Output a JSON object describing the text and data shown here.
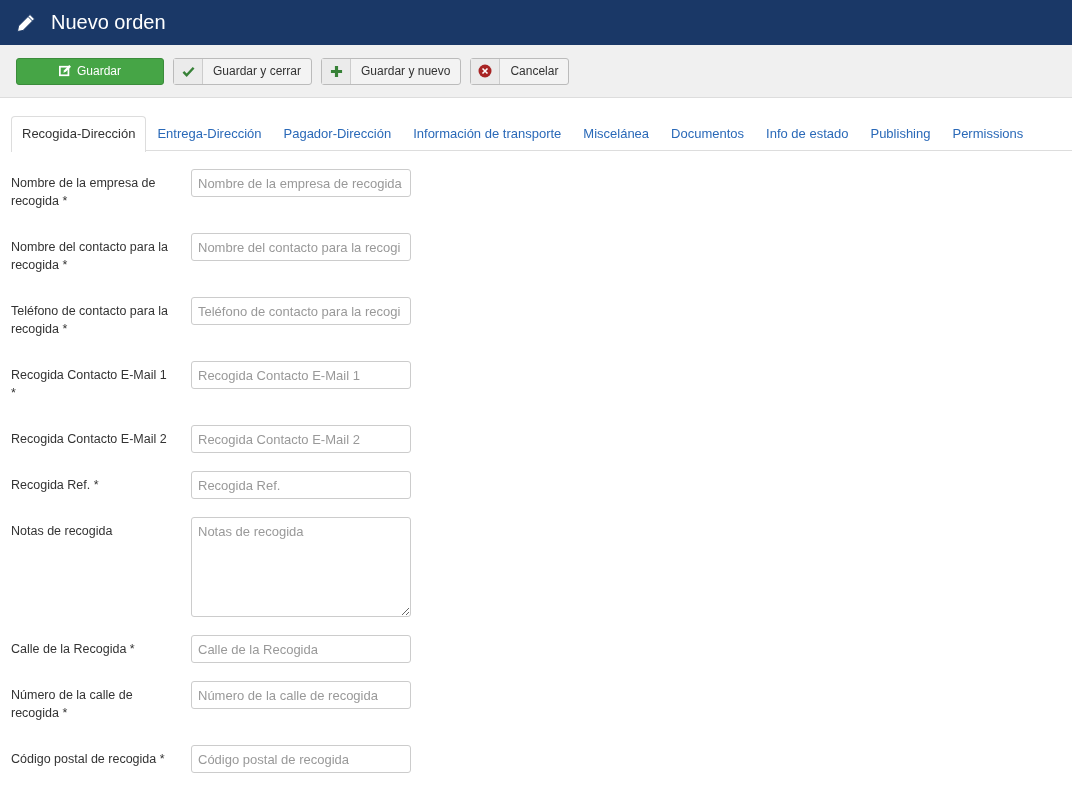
{
  "header": {
    "title": "Nuevo orden"
  },
  "toolbar": [
    {
      "kind": "primary",
      "label": "Guardar"
    },
    {
      "kind": "icon",
      "label": "Guardar y cerrar"
    },
    {
      "kind": "icon",
      "label": "Guardar y nuevo"
    },
    {
      "kind": "icon",
      "label": "Cancelar"
    }
  ],
  "tabs": [
    {
      "label": "Recogida-Dirección",
      "selected": true
    },
    {
      "label": "Entrega-Dirección",
      "selected": false
    },
    {
      "label": "Pagador-Dirección",
      "selected": false
    },
    {
      "label": "Información de transporte",
      "selected": false
    },
    {
      "label": "Miscelánea",
      "selected": false
    },
    {
      "label": "Documentos",
      "selected": false
    },
    {
      "label": "Info de estado",
      "selected": false
    },
    {
      "label": "Publishing",
      "selected": false
    },
    {
      "label": "Permissions",
      "selected": false
    }
  ],
  "fields": [
    {
      "kind": "input",
      "label": "Nombre de la empresa de recogida *",
      "placeholder": "Nombre de la empresa de recogida"
    },
    {
      "kind": "input",
      "label": "Nombre del contacto para la recogida *",
      "placeholder": "Nombre del contacto para la recogi"
    },
    {
      "kind": "input",
      "label": "Teléfono de contacto para la recogida *",
      "placeholder": "Teléfono de contacto para la recogi"
    },
    {
      "kind": "input",
      "label": "Recogida Contacto E-Mail 1 *",
      "placeholder": "Recogida Contacto E-Mail 1"
    },
    {
      "kind": "input",
      "label": "Recogida Contacto E-Mail 2",
      "placeholder": "Recogida Contacto E-Mail 2"
    },
    {
      "kind": "input",
      "label": "Recogida Ref. *",
      "placeholder": "Recogida Ref."
    },
    {
      "kind": "textarea",
      "label": "Notas de recogida",
      "placeholder": "Notas de recogida"
    },
    {
      "kind": "input",
      "label": "Calle de la Recogida *",
      "placeholder": "Calle de la Recogida"
    },
    {
      "kind": "input",
      "label": "Número de la calle de recogida *",
      "placeholder": "Número de la calle de recogida"
    },
    {
      "kind": "input",
      "label": "Código postal de recogida *",
      "placeholder": "Código postal de recogida"
    }
  ]
}
